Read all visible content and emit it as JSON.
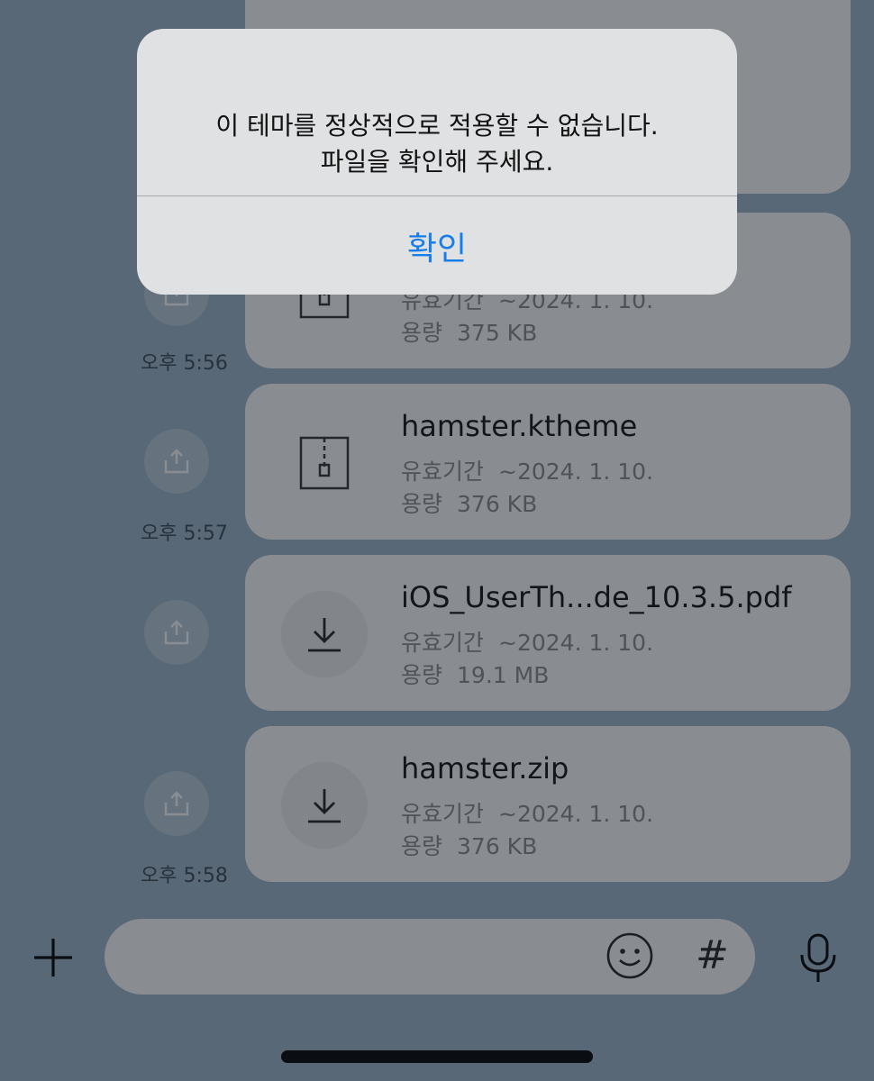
{
  "alert": {
    "line1": "이 테마를 정상적으로 적용할 수 없습니다.",
    "line2": "파일을 확인해 주세요.",
    "confirm_label": "확인"
  },
  "files": [
    {
      "name": "",
      "expiry_label": "유효기간",
      "expiry": "~2024. 1. 10.",
      "size_label": "용량",
      "size": "375 KB",
      "time": "오후 5:56",
      "icon": "zip-file-icon"
    },
    {
      "name": "hamster.ktheme",
      "expiry_label": "유효기간",
      "expiry": "~2024. 1. 10.",
      "size_label": "용량",
      "size": "376 KB",
      "time": "오후 5:57",
      "icon": "zip-file-icon"
    },
    {
      "name": "iOS_UserTh...de_10.3.5.pdf",
      "expiry_label": "유효기간",
      "expiry": "~2024. 1. 10.",
      "size_label": "용량",
      "size": "19.1 MB",
      "time": "",
      "icon": "download-icon"
    },
    {
      "name": "hamster.zip",
      "expiry_label": "유효기간",
      "expiry": "~2024. 1. 10.",
      "size_label": "용량",
      "size": "376 KB",
      "time": "오후 5:58",
      "icon": "download-icon"
    }
  ],
  "input_bar": {
    "plus_icon": "plus-icon",
    "emoji_icon": "emoji-icon",
    "hash_label": "#",
    "mic_icon": "microphone-icon"
  },
  "colors": {
    "chat_background": "#9eb4c8",
    "alert_background": "#e0e1e3",
    "accent": "#1a7ee8"
  }
}
